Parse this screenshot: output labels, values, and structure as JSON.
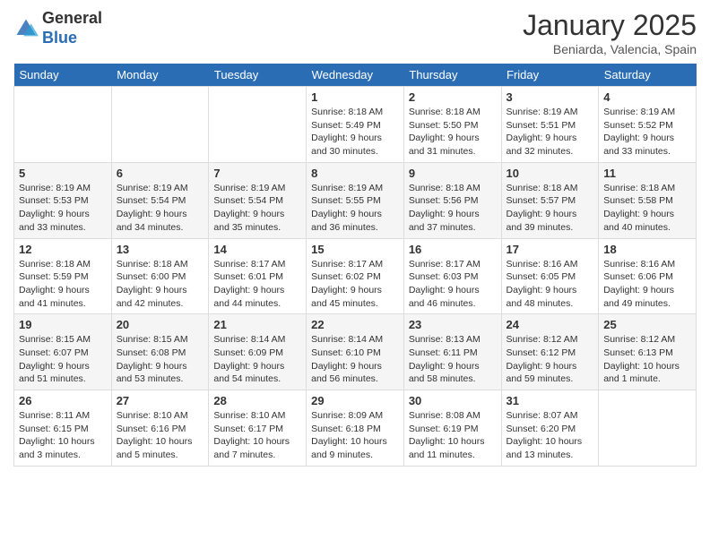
{
  "header": {
    "logo_general": "General",
    "logo_blue": "Blue",
    "month_title": "January 2025",
    "location": "Beniarda, Valencia, Spain"
  },
  "days_of_week": [
    "Sunday",
    "Monday",
    "Tuesday",
    "Wednesday",
    "Thursday",
    "Friday",
    "Saturday"
  ],
  "weeks": [
    [
      {
        "day": "",
        "info": ""
      },
      {
        "day": "",
        "info": ""
      },
      {
        "day": "",
        "info": ""
      },
      {
        "day": "1",
        "info": "Sunrise: 8:18 AM\nSunset: 5:49 PM\nDaylight: 9 hours\nand 30 minutes."
      },
      {
        "day": "2",
        "info": "Sunrise: 8:18 AM\nSunset: 5:50 PM\nDaylight: 9 hours\nand 31 minutes."
      },
      {
        "day": "3",
        "info": "Sunrise: 8:19 AM\nSunset: 5:51 PM\nDaylight: 9 hours\nand 32 minutes."
      },
      {
        "day": "4",
        "info": "Sunrise: 8:19 AM\nSunset: 5:52 PM\nDaylight: 9 hours\nand 33 minutes."
      }
    ],
    [
      {
        "day": "5",
        "info": "Sunrise: 8:19 AM\nSunset: 5:53 PM\nDaylight: 9 hours\nand 33 minutes."
      },
      {
        "day": "6",
        "info": "Sunrise: 8:19 AM\nSunset: 5:54 PM\nDaylight: 9 hours\nand 34 minutes."
      },
      {
        "day": "7",
        "info": "Sunrise: 8:19 AM\nSunset: 5:54 PM\nDaylight: 9 hours\nand 35 minutes."
      },
      {
        "day": "8",
        "info": "Sunrise: 8:19 AM\nSunset: 5:55 PM\nDaylight: 9 hours\nand 36 minutes."
      },
      {
        "day": "9",
        "info": "Sunrise: 8:18 AM\nSunset: 5:56 PM\nDaylight: 9 hours\nand 37 minutes."
      },
      {
        "day": "10",
        "info": "Sunrise: 8:18 AM\nSunset: 5:57 PM\nDaylight: 9 hours\nand 39 minutes."
      },
      {
        "day": "11",
        "info": "Sunrise: 8:18 AM\nSunset: 5:58 PM\nDaylight: 9 hours\nand 40 minutes."
      }
    ],
    [
      {
        "day": "12",
        "info": "Sunrise: 8:18 AM\nSunset: 5:59 PM\nDaylight: 9 hours\nand 41 minutes."
      },
      {
        "day": "13",
        "info": "Sunrise: 8:18 AM\nSunset: 6:00 PM\nDaylight: 9 hours\nand 42 minutes."
      },
      {
        "day": "14",
        "info": "Sunrise: 8:17 AM\nSunset: 6:01 PM\nDaylight: 9 hours\nand 44 minutes."
      },
      {
        "day": "15",
        "info": "Sunrise: 8:17 AM\nSunset: 6:02 PM\nDaylight: 9 hours\nand 45 minutes."
      },
      {
        "day": "16",
        "info": "Sunrise: 8:17 AM\nSunset: 6:03 PM\nDaylight: 9 hours\nand 46 minutes."
      },
      {
        "day": "17",
        "info": "Sunrise: 8:16 AM\nSunset: 6:05 PM\nDaylight: 9 hours\nand 48 minutes."
      },
      {
        "day": "18",
        "info": "Sunrise: 8:16 AM\nSunset: 6:06 PM\nDaylight: 9 hours\nand 49 minutes."
      }
    ],
    [
      {
        "day": "19",
        "info": "Sunrise: 8:15 AM\nSunset: 6:07 PM\nDaylight: 9 hours\nand 51 minutes."
      },
      {
        "day": "20",
        "info": "Sunrise: 8:15 AM\nSunset: 6:08 PM\nDaylight: 9 hours\nand 53 minutes."
      },
      {
        "day": "21",
        "info": "Sunrise: 8:14 AM\nSunset: 6:09 PM\nDaylight: 9 hours\nand 54 minutes."
      },
      {
        "day": "22",
        "info": "Sunrise: 8:14 AM\nSunset: 6:10 PM\nDaylight: 9 hours\nand 56 minutes."
      },
      {
        "day": "23",
        "info": "Sunrise: 8:13 AM\nSunset: 6:11 PM\nDaylight: 9 hours\nand 58 minutes."
      },
      {
        "day": "24",
        "info": "Sunrise: 8:12 AM\nSunset: 6:12 PM\nDaylight: 9 hours\nand 59 minutes."
      },
      {
        "day": "25",
        "info": "Sunrise: 8:12 AM\nSunset: 6:13 PM\nDaylight: 10 hours\nand 1 minute."
      }
    ],
    [
      {
        "day": "26",
        "info": "Sunrise: 8:11 AM\nSunset: 6:15 PM\nDaylight: 10 hours\nand 3 minutes."
      },
      {
        "day": "27",
        "info": "Sunrise: 8:10 AM\nSunset: 6:16 PM\nDaylight: 10 hours\nand 5 minutes."
      },
      {
        "day": "28",
        "info": "Sunrise: 8:10 AM\nSunset: 6:17 PM\nDaylight: 10 hours\nand 7 minutes."
      },
      {
        "day": "29",
        "info": "Sunrise: 8:09 AM\nSunset: 6:18 PM\nDaylight: 10 hours\nand 9 minutes."
      },
      {
        "day": "30",
        "info": "Sunrise: 8:08 AM\nSunset: 6:19 PM\nDaylight: 10 hours\nand 11 minutes."
      },
      {
        "day": "31",
        "info": "Sunrise: 8:07 AM\nSunset: 6:20 PM\nDaylight: 10 hours\nand 13 minutes."
      },
      {
        "day": "",
        "info": ""
      }
    ]
  ]
}
